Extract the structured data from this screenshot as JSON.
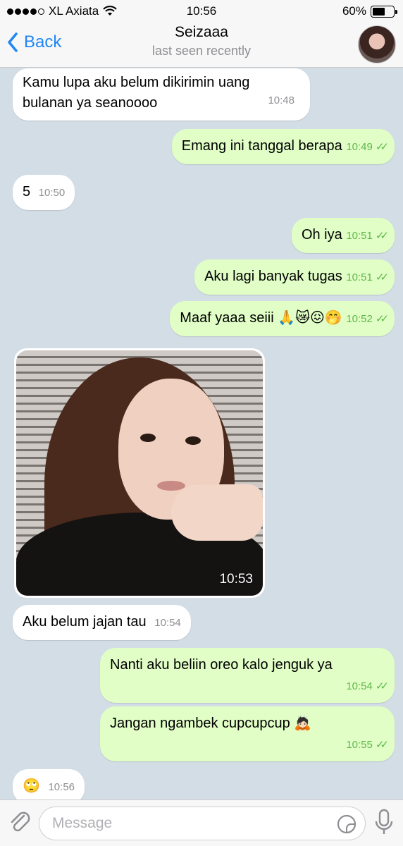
{
  "status_bar": {
    "carrier": "XL Axiata",
    "time": "10:56",
    "battery": "60%",
    "battery_level": 0.6
  },
  "header": {
    "back_label": "Back",
    "title": "Seizaaa",
    "subtitle": "last seen recently"
  },
  "messages": [
    {
      "dir": "in",
      "text": "Kamu lupa aku belum dikirimin uang bulanan ya seanoooo",
      "time": "10:48"
    },
    {
      "dir": "out",
      "text": "Emang ini tanggal berapa",
      "time": "10:49"
    },
    {
      "dir": "in",
      "text": "5",
      "time": "10:50"
    },
    {
      "dir": "out",
      "text": "Oh iya",
      "time": "10:51"
    },
    {
      "dir": "out",
      "text": "Aku lagi banyak tugas",
      "time": "10:51"
    },
    {
      "dir": "out",
      "text": "Maaf yaaa seiii 🙏😿😖🤭",
      "time": "10:52"
    },
    {
      "dir": "in",
      "type": "photo",
      "time": "10:53"
    },
    {
      "dir": "in",
      "text": "Aku belum jajan tau",
      "time": "10:54"
    },
    {
      "dir": "out",
      "text": "Nanti aku beliin oreo kalo jenguk ya",
      "time": "10:54"
    },
    {
      "dir": "out",
      "text": "Jangan ngambek cupcupcup 🙇🏻",
      "time": "10:55"
    },
    {
      "dir": "in",
      "text": "🙄",
      "time": "10:56"
    }
  ],
  "input": {
    "placeholder": "Message"
  },
  "icons": [
    "wifi-icon",
    "battery-icon",
    "back-chevron-icon",
    "attach-icon",
    "sticker-icon",
    "mic-icon",
    "double-check-icon"
  ],
  "colors": {
    "accent": "#1f86f5",
    "outgoing_bubble": "#e1fec6",
    "incoming_bubble": "#ffffff",
    "chat_background": "#d3dde6",
    "outgoing_time": "#5fb74a"
  }
}
